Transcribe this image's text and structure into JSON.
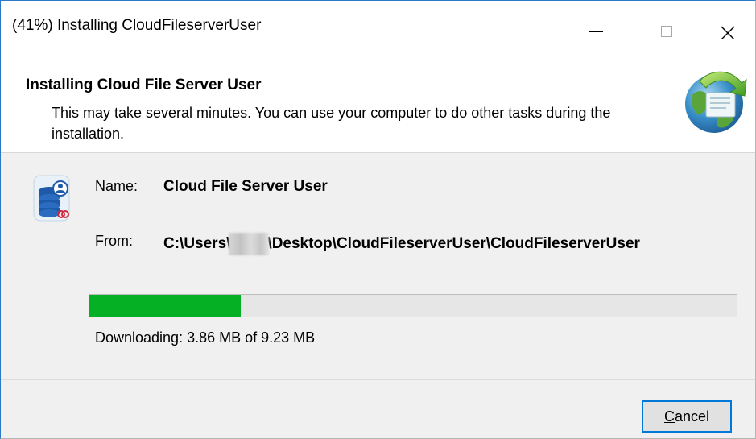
{
  "window": {
    "title": "(41%) Installing CloudFileserverUser",
    "controls": {
      "minimize": "minimize-icon",
      "maximize": "maximize-icon",
      "close": "close-icon"
    }
  },
  "header": {
    "title": "Installing Cloud File Server User",
    "description": "This may take several minutes. You can use your computer to do other tasks during the installation.",
    "icon": "globe-install-icon"
  },
  "app": {
    "icon": "cloud-database-user-icon",
    "name_label": "Name:",
    "name_value": "Cloud File Server User",
    "from_label": "From:",
    "from_prefix": "C:\\Users\\",
    "from_suffix": "\\Desktop\\CloudFileserverUser\\CloudFileserverUser"
  },
  "progress": {
    "fraction": 0.234,
    "status_text": "Downloading: 3.86 MB of 9.23 MB",
    "fill_color": "#06b025"
  },
  "footer": {
    "cancel_mnemonic": "C",
    "cancel_rest": "ancel"
  },
  "colors": {
    "focus_border": "#0078d7",
    "body_background": "#f0f0f0"
  }
}
